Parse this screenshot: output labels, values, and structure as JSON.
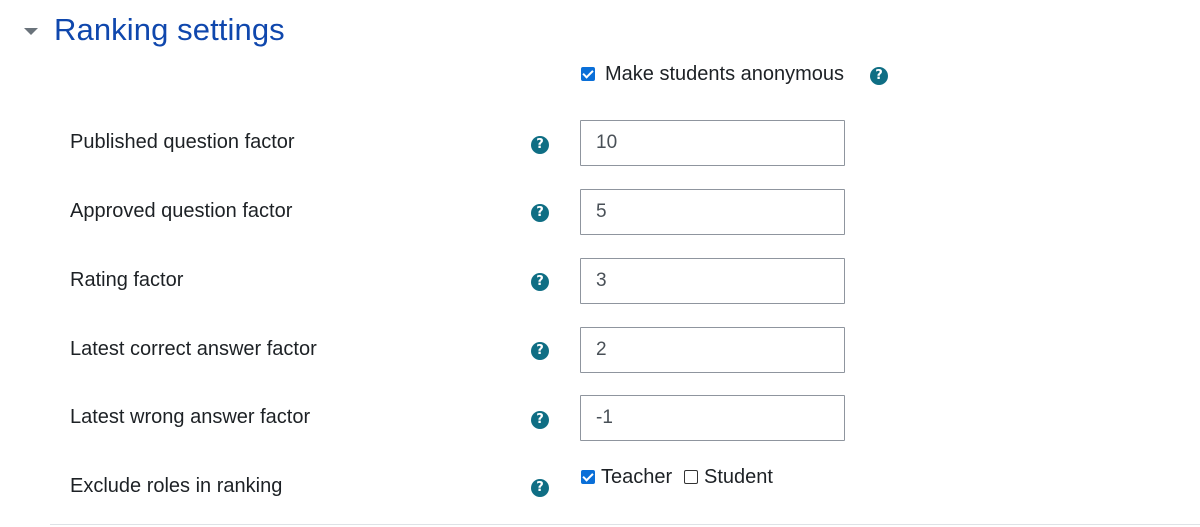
{
  "section": {
    "title": "Ranking settings"
  },
  "anonymous": {
    "label": "Make students anonymous",
    "checked": true
  },
  "fields": [
    {
      "label": "Published question factor",
      "value": "10"
    },
    {
      "label": "Approved question factor",
      "value": "5"
    },
    {
      "label": "Rating factor",
      "value": "3"
    },
    {
      "label": "Latest correct answer factor",
      "value": "2"
    },
    {
      "label": "Latest wrong answer factor",
      "value": "-1"
    }
  ],
  "exclude_roles": {
    "label": "Exclude roles in ranking",
    "options": [
      {
        "label": "Teacher",
        "checked": true
      },
      {
        "label": "Student",
        "checked": false
      }
    ]
  },
  "help_icon_glyph": "?",
  "colors": {
    "title": "#0f47ad",
    "help_icon": "#0f6e84",
    "checkbox_checked": "#0a6fd8",
    "caret": "#6a737b"
  },
  "icons": {
    "collapse": "caret-down-icon",
    "help": "help-circle-icon"
  }
}
